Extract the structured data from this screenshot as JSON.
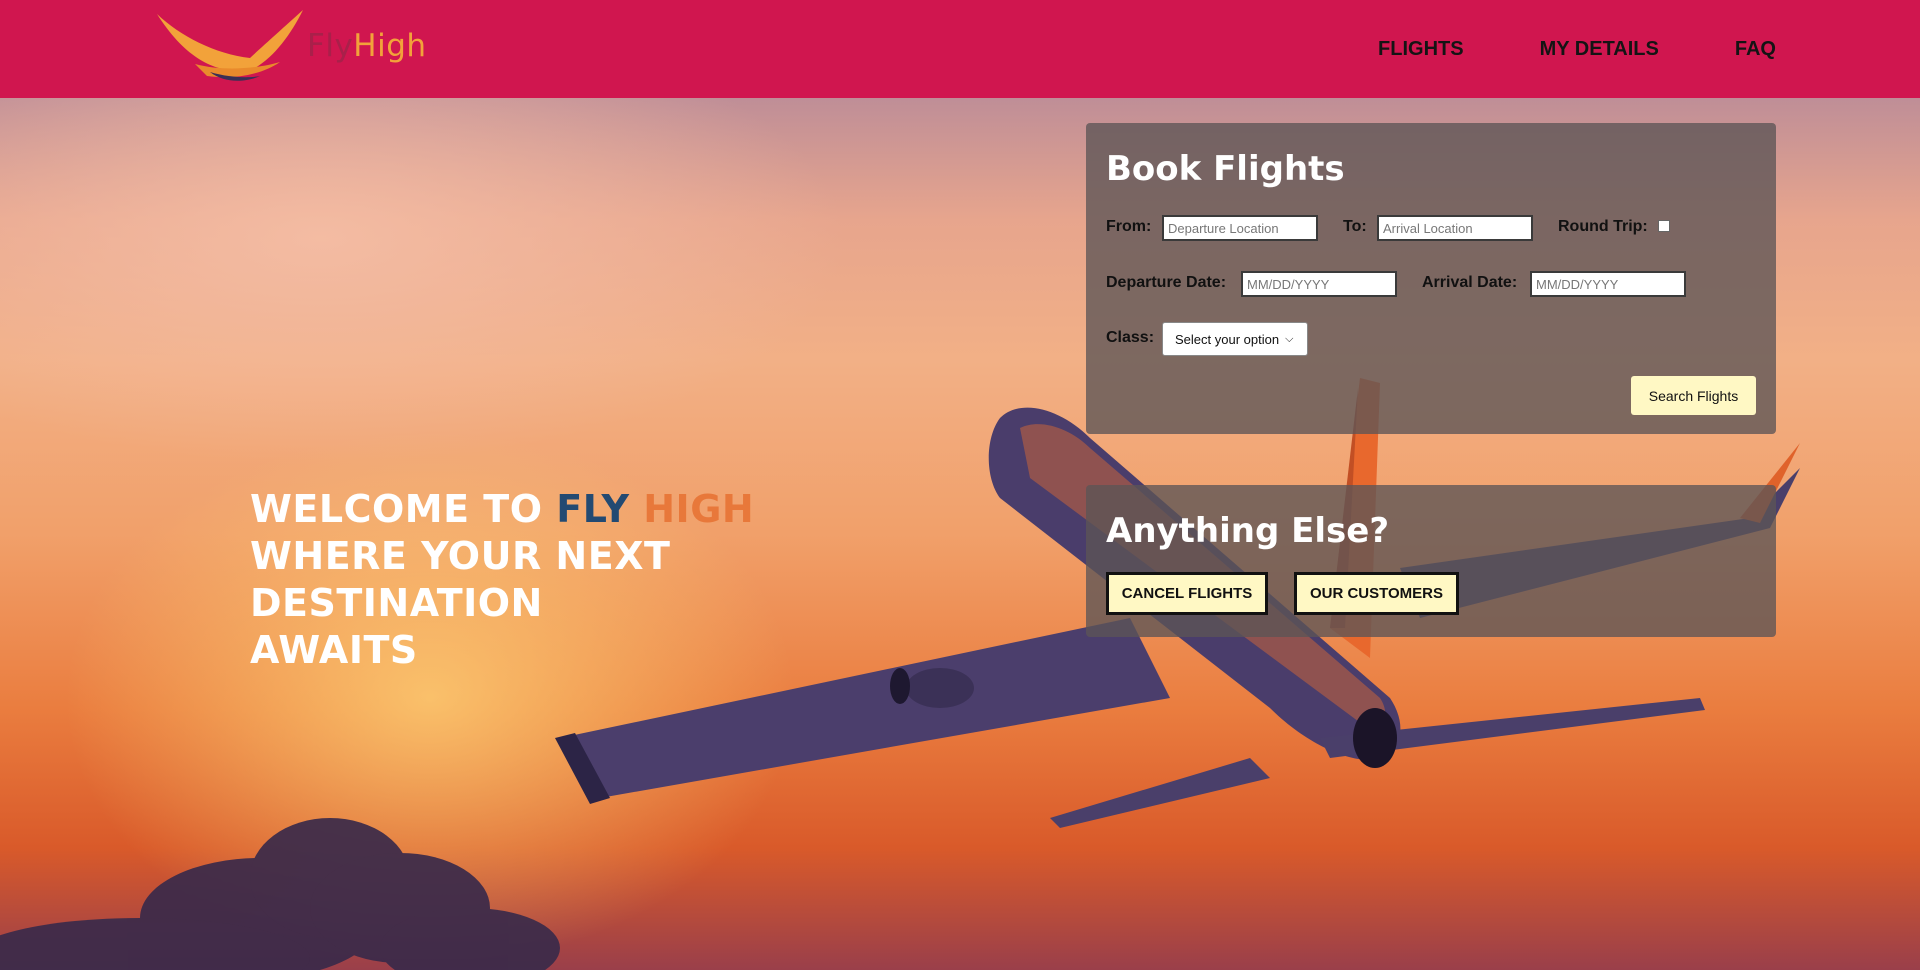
{
  "brand": {
    "name_fly": "Fly",
    "name_high": "High",
    "header_color": "#d0164f"
  },
  "nav": {
    "items": [
      {
        "label": "FLIGHTS"
      },
      {
        "label": "MY DETAILS"
      },
      {
        "label": "FAQ"
      }
    ]
  },
  "hero": {
    "line1_prefix": "WELCOME TO ",
    "line1_fly": "FLY",
    "line1_high": "HIGH",
    "line2": "WHERE YOUR NEXT DESTINATION",
    "line3": "AWAITS"
  },
  "booking": {
    "title": "Book Flights",
    "from_label": "From:",
    "from_placeholder": "Departure Location",
    "to_label": "To:",
    "to_placeholder": "Arrival Location",
    "round_trip_label": "Round Trip:",
    "departure_date_label": "Departure Date:",
    "departure_date_placeholder": "MM/DD/YYYY",
    "arrival_date_label": "Arrival Date:",
    "arrival_date_placeholder": "MM/DD/YYYY",
    "class_label": "Class:",
    "class_selected": "Select your option",
    "search_button": "Search Flights"
  },
  "extra": {
    "title": "Anything Else?",
    "cancel_button": "CANCEL FLIGHTS",
    "customers_button": "OUR CUSTOMERS"
  }
}
